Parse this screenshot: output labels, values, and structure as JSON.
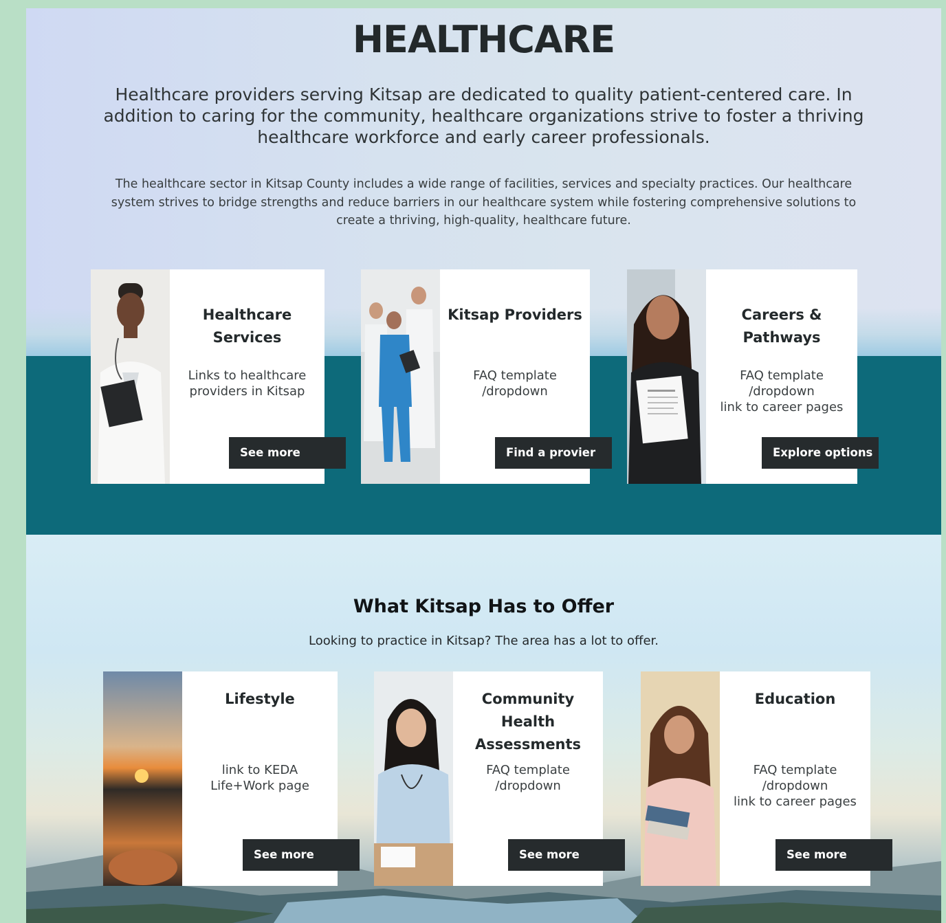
{
  "header": {
    "title": "HEALTHCARE",
    "lead": "Healthcare providers serving Kitsap are dedicated to quality patient-centered care. In addition to caring for the community, healthcare organizations strive to foster a thriving healthcare workforce and early career professionals.",
    "sub": "The healthcare sector in Kitsap County includes a wide range of facilities, services and specialty practices. Our healthcare system strives to bridge strengths and reduce barriers in our healthcare system while fostering comprehensive solutions to create a thriving, high-quality, healthcare future."
  },
  "top_cards": [
    {
      "title": "Healthcare Services",
      "desc": "Links to healthcare providers in Kitsap",
      "button": "See more",
      "image": "doctor-with-clipboard"
    },
    {
      "title": "Kitsap Providers",
      "desc": "FAQ template\n/dropdown",
      "button": "Find a provier",
      "image": "medical-team"
    },
    {
      "title": "Careers & Pathways",
      "desc": "FAQ template\n/dropdown\nlink to career pages",
      "button": "Explore options",
      "image": "woman-with-resume"
    }
  ],
  "offer": {
    "title": "What Kitsap Has to Offer",
    "subtitle": "Looking to practice in Kitsap? The area has a lot to offer."
  },
  "bottom_cards": [
    {
      "title": "Lifestyle",
      "desc": "link to KEDA\nLife+Work page",
      "button": "See more",
      "image": "sunset-kayak"
    },
    {
      "title": "Community Health Assessments",
      "desc": "FAQ template\n/dropdown",
      "button": "See more",
      "image": "doctor-consultation"
    },
    {
      "title": "Education",
      "desc": "FAQ template\n/dropdown\nlink to career pages",
      "button": "See more",
      "image": "student-with-books"
    }
  ],
  "colors": {
    "teal_band": "#0d6a7a",
    "button": "#262b2d",
    "outer_border": "#b9dfc6"
  }
}
